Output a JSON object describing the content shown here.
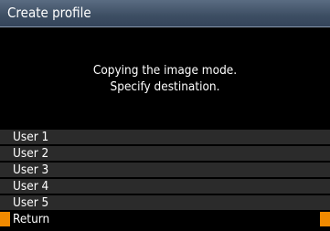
{
  "window": {
    "title": "Create profile"
  },
  "message": {
    "line1": "Copying the image mode.",
    "line2": "Specify destination."
  },
  "menu": {
    "items": [
      {
        "label": "User 1",
        "selected": false
      },
      {
        "label": "User 2",
        "selected": false
      },
      {
        "label": "User 3",
        "selected": false
      },
      {
        "label": "User 4",
        "selected": false
      },
      {
        "label": "User 5",
        "selected": false
      },
      {
        "label": "Return",
        "selected": true
      }
    ]
  },
  "colors": {
    "selection_accent": "#f08a00",
    "title_bar": "#3d4e63",
    "menu_row": "#2b2b2b"
  }
}
